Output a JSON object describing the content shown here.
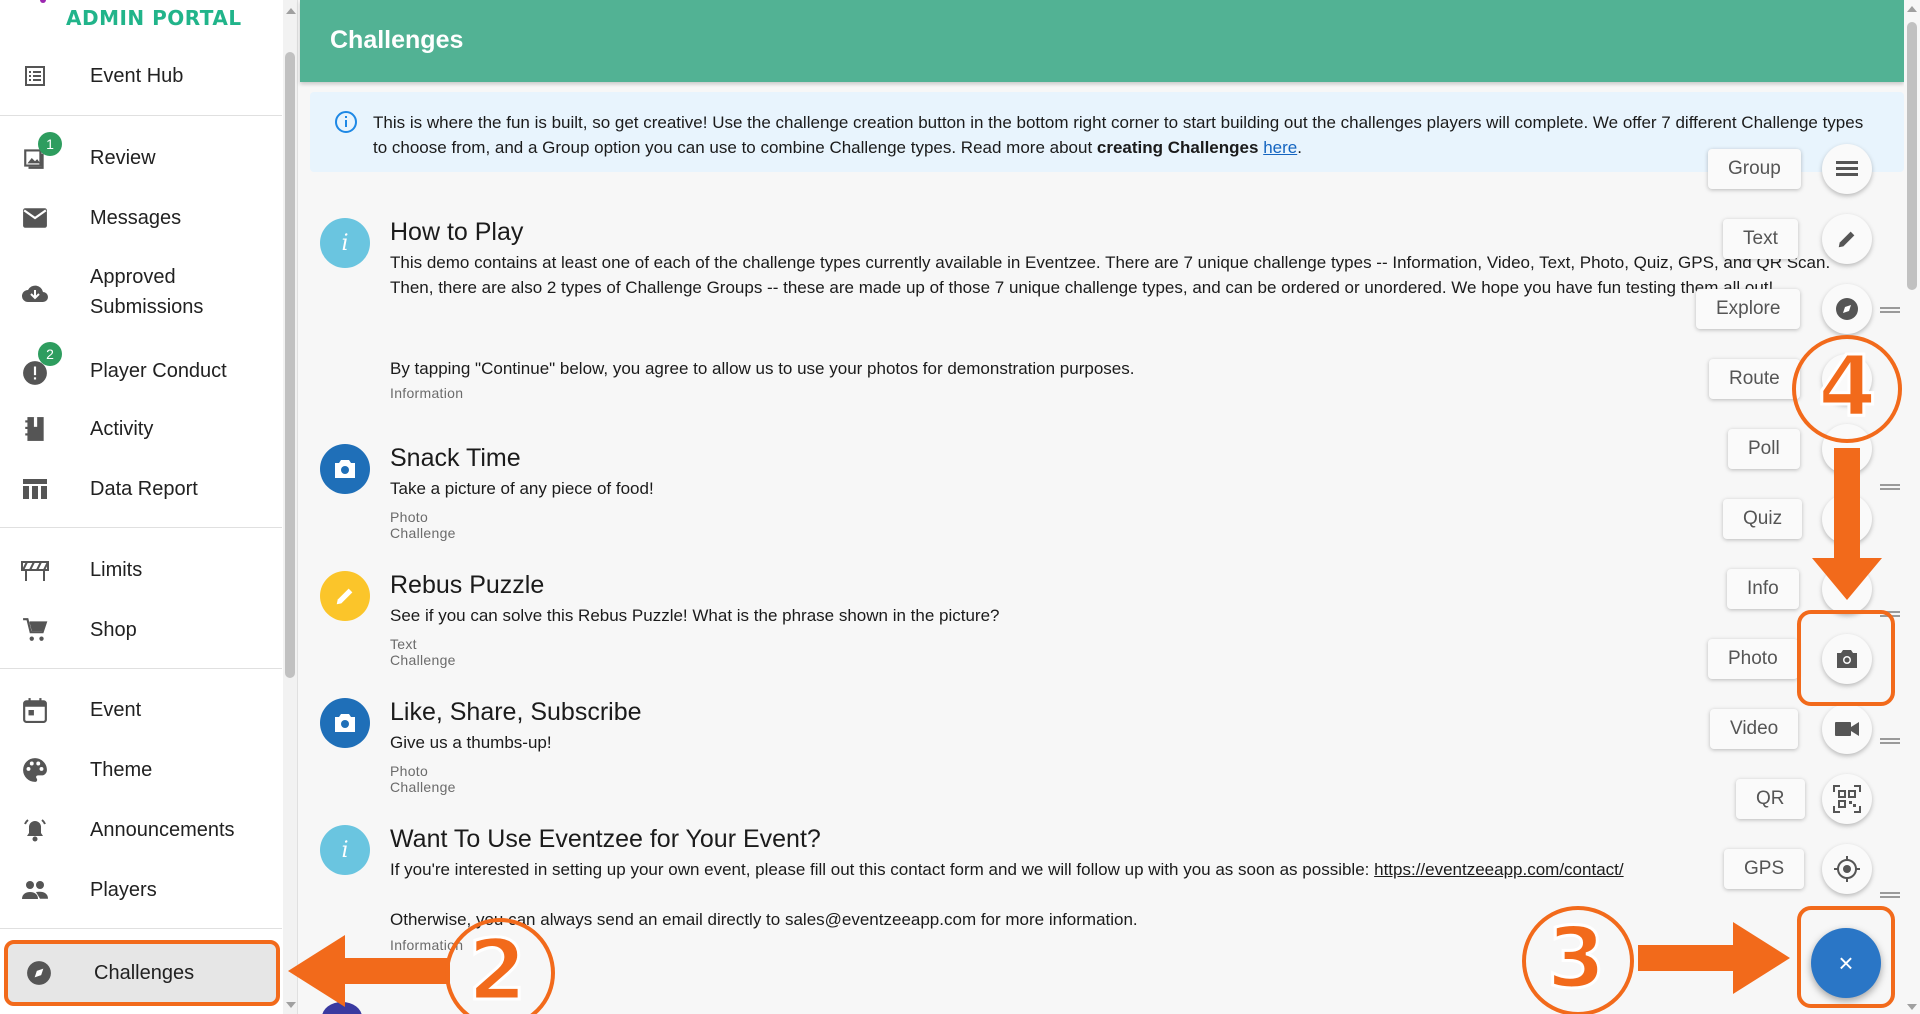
{
  "brand": "ADMIN PORTAL",
  "sidebar": {
    "items": [
      {
        "label": "Event Hub",
        "icon": "list-icon"
      },
      {
        "label": "Review",
        "icon": "image-icon",
        "badge": "1"
      },
      {
        "label": "Messages",
        "icon": "mail-icon"
      },
      {
        "label": "Approved Submissions",
        "icon": "cloud-download-icon"
      },
      {
        "label": "Player Conduct",
        "icon": "alert-icon",
        "badge": "2"
      },
      {
        "label": "Activity",
        "icon": "notebook-icon"
      },
      {
        "label": "Data Report",
        "icon": "table-icon"
      },
      {
        "label": "Limits",
        "icon": "barrier-icon"
      },
      {
        "label": "Shop",
        "icon": "cart-icon"
      },
      {
        "label": "Event",
        "icon": "calendar-icon"
      },
      {
        "label": "Theme",
        "icon": "palette-icon"
      },
      {
        "label": "Announcements",
        "icon": "bell-ring-icon"
      },
      {
        "label": "Players",
        "icon": "people-icon"
      },
      {
        "label": "Challenges",
        "icon": "compass-icon",
        "active": true
      }
    ]
  },
  "header": {
    "title": "Challenges"
  },
  "info": {
    "text_before": "This is where the fun is built, so get creative! Use the challenge creation button in the bottom right corner to start building out the challenges players will complete. We offer 7 different Challenge types to choose from, and a Group option you can use to combine Challenge types. Read more about ",
    "bold": "creating Challenges",
    "link": "here",
    "end": "."
  },
  "challenges": [
    {
      "title": "How to Play",
      "desc": "This demo contains at least one of each of the challenge types currently available in Eventzee. There are 7 unique challenge types -- Information, Video, Text, Photo, Quiz, GPS, and QR Scan. Then, there are also 2 types of Challenge Groups -- these are made up of those 7 unique challenge types, and can be ordered or unordered. We hope you have fun testing them all out!",
      "desc2": "By tapping \"Continue\" below, you agree to allow us to use your photos for demonstration purposes.",
      "type": "Information"
    },
    {
      "title": "Snack Time",
      "desc": "Take a picture of any piece of food!",
      "type": "Photo Challenge"
    },
    {
      "title": "Rebus Puzzle",
      "desc": "See if you can solve this Rebus Puzzle! What is the phrase shown in the picture?",
      "type": "Text Challenge"
    },
    {
      "title": "Like, Share, Subscribe",
      "desc": "Give us a thumbs-up!",
      "type": "Photo Challenge"
    },
    {
      "title": "Want To Use Eventzee for Your Event?",
      "desc": "If you're interested in setting up your own event, please fill out this contact form and we will follow up with you as soon as possible: ",
      "link": "https://eventzeeapp.com/contact/",
      "desc2": "Otherwise, you can always send an email directly to sales@eventzeeapp.com for more information.",
      "type": "Information"
    }
  ],
  "speed_dial": [
    {
      "label": "Group",
      "icon": "group-icon"
    },
    {
      "label": "Text",
      "icon": "pencil-icon"
    },
    {
      "label": "Explore",
      "icon": "compass-icon"
    },
    {
      "label": "Route",
      "icon": "route-icon"
    },
    {
      "label": "Poll",
      "icon": "poll-icon"
    },
    {
      "label": "Quiz",
      "icon": "quiz-icon"
    },
    {
      "label": "Info",
      "icon": "info-icon"
    },
    {
      "label": "Photo",
      "icon": "camera-icon"
    },
    {
      "label": "Video",
      "icon": "video-icon"
    },
    {
      "label": "QR",
      "icon": "qr-icon"
    },
    {
      "label": "GPS",
      "icon": "gps-icon"
    }
  ],
  "fab": {
    "symbol": "×"
  },
  "annotations": {
    "step2": "2",
    "step3": "3",
    "step4": "4"
  },
  "colors": {
    "header": "#52b294",
    "accent": "#f26a1b",
    "fab": "#2a76c6",
    "brand": "#21b48a"
  }
}
